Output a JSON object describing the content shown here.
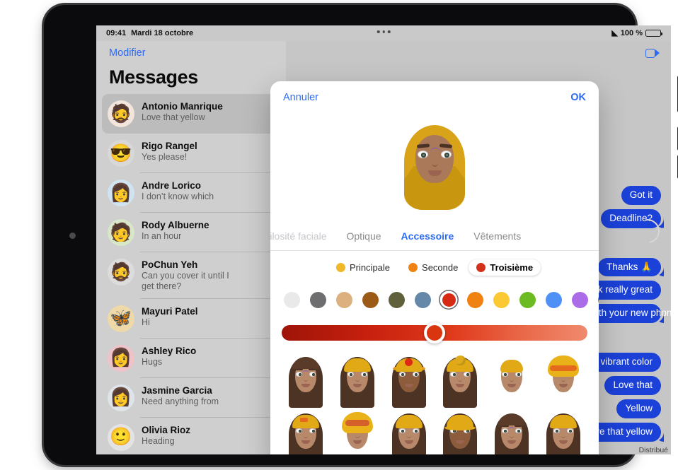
{
  "status_bar": {
    "time": "09:41",
    "date": "Mardi 18 octobre",
    "battery_percent": "100 %",
    "wifi_icon": "wifi-icon",
    "battery_icon": "battery-icon"
  },
  "sidebar": {
    "edit_label": "Modifier",
    "title": "Messages",
    "conversations": [
      {
        "name": "Antonio Manrique",
        "preview": "Love that yellow",
        "avatar": "🧔",
        "avatar_bg": "#f2e6dc",
        "selected": true
      },
      {
        "name": "Rigo Rangel",
        "preview": "Yes please!",
        "avatar": "😎",
        "avatar_bg": "#d8d8d8",
        "selected": false
      },
      {
        "name": "Andre Lorico",
        "preview": "I don’t know which",
        "avatar": "👩",
        "avatar_bg": "#cfe3f0",
        "selected": false
      },
      {
        "name": "Rody Albuerne",
        "preview": "In an hour",
        "avatar": "🧑",
        "avatar_bg": "#d9e7c9",
        "selected": false
      },
      {
        "name": "PoChun Yeh",
        "preview": "Can you cover it until I\nget there?",
        "avatar": "🧔",
        "avatar_bg": "#dcdcdc",
        "selected": false
      },
      {
        "name": "Mayuri Patel",
        "preview": "Hi",
        "avatar": "🦋",
        "avatar_bg": "#efd9a8",
        "selected": false
      },
      {
        "name": "Ashley Rico",
        "preview": "Hugs",
        "avatar": "👩",
        "avatar_bg": "#f0c3c9",
        "selected": false
      },
      {
        "name": "Jasmine Garcia",
        "preview": "Need anything from",
        "avatar": "👩",
        "avatar_bg": "#dfe4ea",
        "selected": false
      },
      {
        "name": "Olivia Rioz",
        "preview": "Heading",
        "avatar": "🙂",
        "avatar_bg": "#e3e3e3",
        "selected": false
      }
    ]
  },
  "conversation": {
    "facetime_icon": "facetime-video-icon",
    "bubbles": [
      {
        "text": "Got it",
        "tail": false
      },
      {
        "text": "Deadline?",
        "tail": true
      },
      {
        "text": "Thanks 🙏",
        "tail": true
      },
      {
        "text": "These look really great",
        "tail": false
      },
      {
        "text": "How is everything going with your new phone?",
        "tail": true
      },
      {
        "text": "I can’t believe the vibrant color",
        "tail": false
      },
      {
        "text": "Love that",
        "tail": false
      },
      {
        "text": "Yellow",
        "tail": false
      },
      {
        "text": "Love that yellow",
        "tail": true
      }
    ],
    "delivered_label": "Distribué"
  },
  "modal": {
    "cancel_label": "Annuler",
    "ok_label": "OK",
    "tabs": [
      {
        "label": "Pilosité faciale",
        "state": "clipped"
      },
      {
        "label": "Optique",
        "state": "inactive"
      },
      {
        "label": "Accessoire",
        "state": "active"
      },
      {
        "label": "Vêtements",
        "state": "inactive"
      }
    ],
    "palette_segments": [
      {
        "label": "Principale",
        "dot_color": "#f0b827",
        "active": false
      },
      {
        "label": "Seconde",
        "dot_color": "#ef8211",
        "active": false
      },
      {
        "label": "Troisième",
        "dot_color": "#d4301a",
        "active": true
      }
    ],
    "swatches": [
      {
        "color": "#e9e9e9",
        "selected": false
      },
      {
        "color": "#6e6e70",
        "selected": false
      },
      {
        "color": "#dcb07f",
        "selected": false
      },
      {
        "color": "#9c5a17",
        "selected": false
      },
      {
        "color": "#60603c",
        "selected": false
      },
      {
        "color": "#6688a8",
        "selected": false
      },
      {
        "color": "#d62a12",
        "selected": true
      },
      {
        "color": "#ef8211",
        "selected": false
      },
      {
        "color": "#fbc933",
        "selected": false
      },
      {
        "color": "#6cbb22",
        "selected": false
      },
      {
        "color": "#4e90f5",
        "selected": false
      },
      {
        "color": "#ab6ce8",
        "selected": false
      },
      {
        "color": "#ef4d8a",
        "selected": false
      }
    ],
    "slider": {
      "name": "shade-slider",
      "value_percent": 50,
      "gradient_from": "#9e1408",
      "gradient_to": "#f08a6d",
      "thumb_color": "#d9360f"
    },
    "options": [
      {
        "row": 1,
        "index": 1,
        "headwear": "none",
        "hair": "long-center-part",
        "skin": "light"
      },
      {
        "row": 1,
        "index": 2,
        "headwear": "cap",
        "hair": "long",
        "skin": "light"
      },
      {
        "row": 1,
        "index": 3,
        "headwear": "dot-hat",
        "hair": "long",
        "skin": "dark"
      },
      {
        "row": 1,
        "index": 4,
        "headwear": "bun-wrap",
        "hair": "long",
        "skin": "light"
      },
      {
        "row": 1,
        "index": 5,
        "headwear": "skull-cap",
        "hair": "none",
        "skin": "light"
      },
      {
        "row": 1,
        "index": 6,
        "headwear": "turban-band",
        "hair": "none",
        "skin": "light"
      },
      {
        "row": 2,
        "index": 1,
        "headwear": "cap-patch",
        "hair": "long",
        "skin": "light"
      },
      {
        "row": 2,
        "index": 2,
        "headwear": "goggles-wrap",
        "hair": "none",
        "skin": "light"
      },
      {
        "row": 2,
        "index": 3,
        "headwear": "cap",
        "hair": "long",
        "skin": "light"
      },
      {
        "row": 2,
        "index": 4,
        "headwear": "cap-brim",
        "hair": "long",
        "skin": "dark"
      },
      {
        "row": 2,
        "index": 5,
        "headwear": "none",
        "hair": "long-center-part",
        "skin": "light"
      },
      {
        "row": 2,
        "index": 6,
        "headwear": "cap",
        "hair": "long",
        "skin": "light"
      }
    ]
  }
}
